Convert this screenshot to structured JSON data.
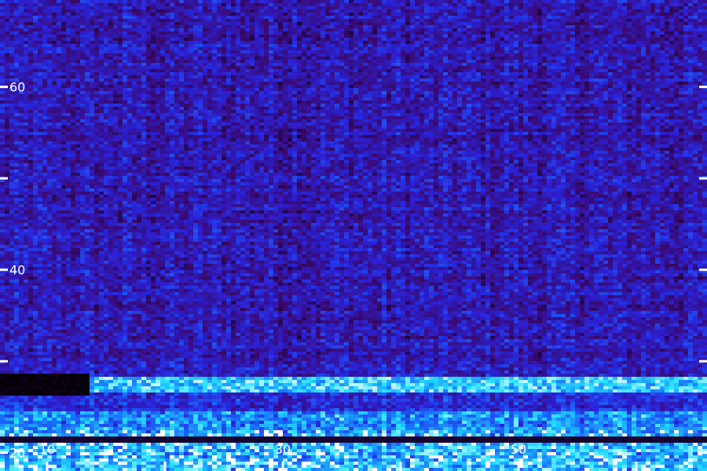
{
  "chart_data": {
    "type": "heatmap",
    "title": "",
    "xlabel": "",
    "ylabel": "",
    "xlim": [
      6,
      66
    ],
    "ylim": [
      18,
      69.5
    ],
    "x_tick_labels": [
      "10",
      "30",
      "50"
    ],
    "x_minor_ticks": [
      0,
      10,
      20,
      30,
      40,
      50,
      60
    ],
    "y_tick_labels": [
      "20",
      "40",
      "60"
    ],
    "y_ticks_all": [
      20,
      30,
      40,
      50,
      60
    ],
    "colormap": [
      "#000000",
      "#3a0a72",
      "#2a22d8",
      "#1a6cff",
      "#22e0ff",
      "#ffffff"
    ],
    "features": [
      {
        "name": "low-band",
        "y": 27.5,
        "x_from": 13.5,
        "x_to": 66,
        "intensity": 0.95
      },
      {
        "name": "silent-gap",
        "y": 27.5,
        "x_from": 6,
        "x_to": 13.5,
        "intensity": 0.0
      },
      {
        "name": "floor-band",
        "y": 21.5,
        "x_from": 6,
        "x_to": 66,
        "intensity": 0.55
      }
    ]
  }
}
